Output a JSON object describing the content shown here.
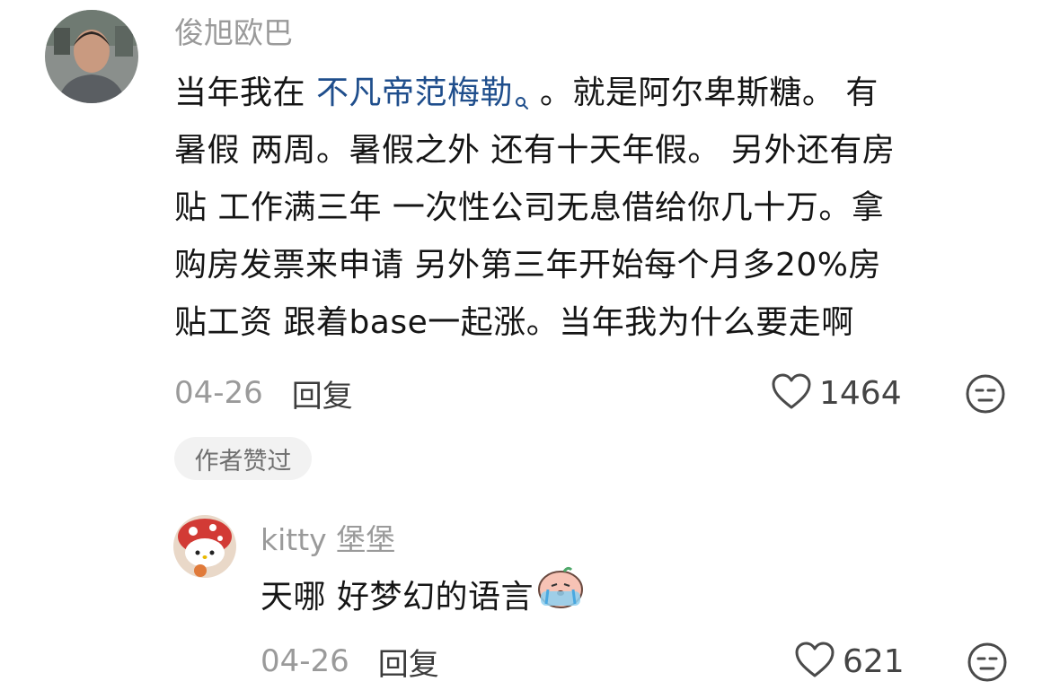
{
  "comment": {
    "username": "俊旭欧巴",
    "text_lines": [
      {
        "before": "当年我在 ",
        "link": "不凡帝范梅勒",
        "after": " 。就是阿尔卑斯糖。 有"
      },
      {
        "text": "暑假 两周。暑假之外 还有十天年假。 另外还有房"
      },
      {
        "text": "贴 工作满三年 一次性公司无息借给你几十万。拿"
      },
      {
        "text": "购房发票来申请 另外第三年开始每个月多20%房"
      },
      {
        "text": "贴工资 跟着base一起涨。当年我为什么要走啊"
      }
    ],
    "date": "04-26",
    "reply_label": "回复",
    "like_count": "1464",
    "author_liked_label": "作者赞过"
  },
  "reply": {
    "username": "kitty 堡堡",
    "text": "天哪 好梦幻的语言",
    "date": "04-26",
    "reply_label": "回复",
    "like_count": "621"
  },
  "colors": {
    "link": "#1f4e8c",
    "meta_gray": "#9a9a9a",
    "pill_bg": "#f2f2f2"
  },
  "icons": {
    "like": "heart-outline-icon",
    "dislike": "unamused-face-icon",
    "search_hint": "search-magnifier-icon",
    "sticker": "crying-sticker-emoji"
  }
}
